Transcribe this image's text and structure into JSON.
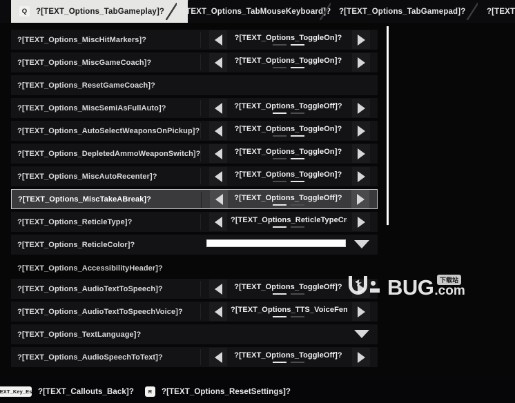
{
  "tabs": {
    "keycap": "Q",
    "items": [
      {
        "label": "?[TEXT_Options_TabGameplay]?",
        "active": true
      },
      {
        "label": "?[TEXT_Options_TabMouseKeyboard]?",
        "active": false
      },
      {
        "label": "?[TEXT_Options_TabGamepad]?",
        "active": false
      },
      {
        "label": "?[TEXT",
        "active": false
      }
    ]
  },
  "options": [
    {
      "label": "?[TEXT_Options_MiscHitMarkers]?",
      "type": "stepper",
      "value": "?[TEXT_Options_ToggleOn]?",
      "pip": 1
    },
    {
      "label": "?[TEXT_Options_MiscGameCoach]?",
      "type": "stepper",
      "value": "?[TEXT_Options_ToggleOn]?",
      "pip": 1
    },
    {
      "label": "?[TEXT_Options_ResetGameCoach]?",
      "type": "action"
    },
    {
      "label": "?[TEXT_Options_MiscSemiAsFullAuto]?",
      "type": "stepper",
      "value": "?[TEXT_Options_ToggleOff]?",
      "pip": 0
    },
    {
      "label": "?[TEXT_Options_AutoSelectWeaponsOnPickup]?",
      "type": "stepper",
      "value": "?[TEXT_Options_ToggleOn]?",
      "pip": 1
    },
    {
      "label": "?[TEXT_Options_DepletedAmmoWeaponSwitch]?",
      "type": "stepper",
      "value": "?[TEXT_Options_ToggleOn]?",
      "pip": 1
    },
    {
      "label": "?[TEXT_Options_MiscAutoRecenter]?",
      "type": "stepper",
      "value": "?[TEXT_Options_ToggleOn]?",
      "pip": 1
    },
    {
      "label": "?[TEXT_Options_MiscTakeABreak]?",
      "type": "stepper",
      "value": "?[TEXT_Options_ToggleOff]?",
      "pip": 0,
      "selected": true
    },
    {
      "label": "?[TEXT_Options_ReticleType]?",
      "type": "stepper",
      "value": "?[TEXT_Options_ReticleTypeCrosshair]?",
      "pip": 0,
      "clipped": true
    },
    {
      "label": "?[TEXT_Options_ReticleColor]?",
      "type": "color",
      "swatch_color": "#ffffff"
    },
    {
      "label": "?[TEXT_Options_AccessibilityHeader]?",
      "type": "section"
    },
    {
      "label": "?[TEXT_Options_AudioTextToSpeech]?",
      "type": "stepper",
      "value": "?[TEXT_Options_ToggleOff]?",
      "pip": 0
    },
    {
      "label": "?[TEXT_Options_AudioTextToSpeechVoice]?",
      "type": "stepper",
      "value": "?[TEXT_Options_TTS_VoiceFemale]?",
      "pip": 0,
      "clipped": true
    },
    {
      "label": "?[TEXT_Options_TextLanguage]?",
      "type": "dropdown"
    },
    {
      "label": "?[TEXT_Options_AudioSpeechToText]?",
      "type": "stepper",
      "value": "?[TEXT_Options_ToggleOff]?",
      "pip": 0
    }
  ],
  "watermark": {
    "brand": "BUG",
    "suffix": ".com",
    "badge": "下载站"
  },
  "bottom_bar": {
    "back": {
      "keycap": "TEXT_Key_Escape]",
      "label": "?[TEXT_Callouts_Back]?"
    },
    "reset": {
      "keycap": "R",
      "label": "?[TEXT_Options_ResetSettings]?"
    }
  },
  "colors": {
    "page_background": "#070708",
    "row_background": "#131315",
    "selected_row": "#3a3a3c",
    "accent_text": "#e9e9ea",
    "scrollbar": "#ffffff"
  }
}
